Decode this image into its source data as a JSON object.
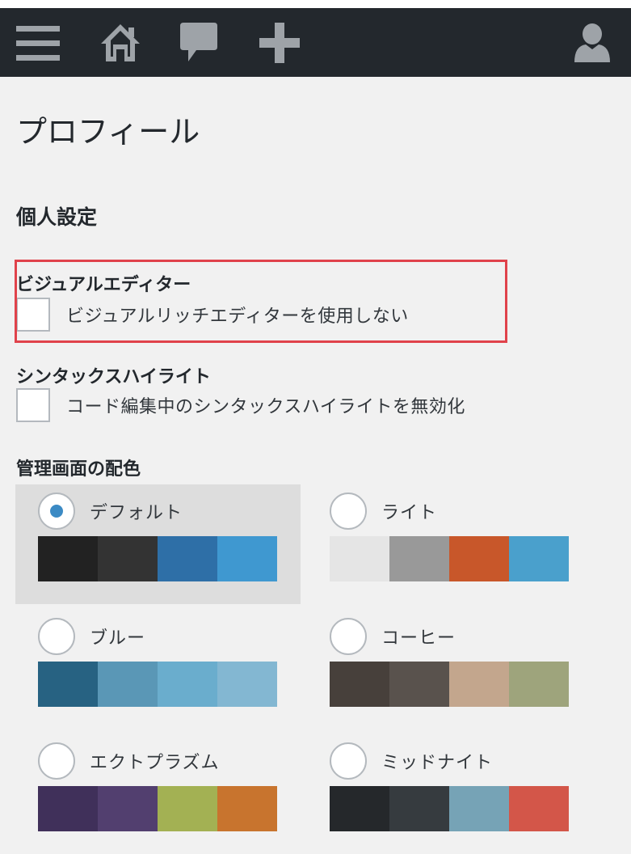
{
  "adminbar": {
    "items": [
      {
        "name": "menu-icon",
        "glyph": "menu"
      },
      {
        "name": "home-icon",
        "glyph": "home"
      },
      {
        "name": "comments-icon",
        "glyph": "comment"
      },
      {
        "name": "new-content-icon",
        "glyph": "plus"
      },
      {
        "name": "account-icon",
        "glyph": "user"
      }
    ],
    "background": "#23282d",
    "icon_color": "#9ea3a8"
  },
  "page": {
    "title": "プロフィール",
    "section_title": "個人設定"
  },
  "visual_editor": {
    "label": "ビジュアルエディター",
    "option": "ビジュアルリッチエディターを使用しない",
    "checked": false
  },
  "syntax_highlight": {
    "label": "シンタックスハイライト",
    "option": "コード編集中のシンタックスハイライトを無効化",
    "checked": false
  },
  "color_scheme": {
    "label": "管理画面の配色",
    "schemes": [
      {
        "name": "デフォルト",
        "selected": true,
        "colors": [
          "#222222",
          "#333333",
          "#2e6fa7",
          "#3f98d0"
        ]
      },
      {
        "name": "ライト",
        "selected": false,
        "colors": [
          "#e5e5e5",
          "#999999",
          "#c8572a",
          "#4aa0cc"
        ]
      },
      {
        "name": "ブルー",
        "selected": false,
        "colors": [
          "#276282",
          "#5a97b6",
          "#6aadcd",
          "#83b7d2"
        ]
      },
      {
        "name": "コーヒー",
        "selected": false,
        "colors": [
          "#47403b",
          "#59524d",
          "#c3a68d",
          "#9ea47c"
        ]
      },
      {
        "name": "エクトプラズム",
        "selected": false,
        "colors": [
          "#40305a",
          "#523f6f",
          "#a3b153",
          "#c8742e"
        ]
      },
      {
        "name": "ミッドナイト",
        "selected": false,
        "colors": [
          "#25282b",
          "#363b3f",
          "#76a3b6",
          "#d35649"
        ]
      }
    ]
  },
  "colors": {
    "highlight_border": "#e0424b",
    "radio_selected": "#3b8ac4"
  }
}
